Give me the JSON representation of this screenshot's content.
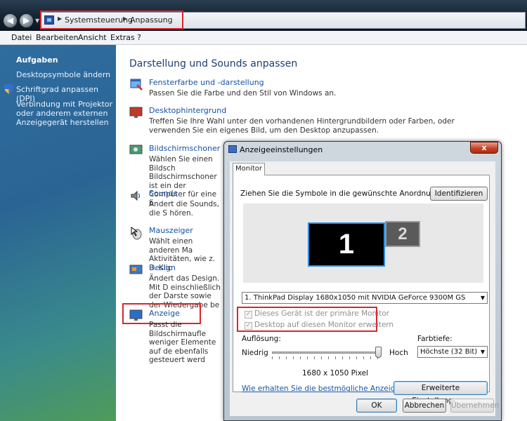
{
  "breadcrumb": {
    "items": [
      "Systemsteuerung",
      "Anpassung"
    ]
  },
  "menu": [
    "Datei",
    "Bearbeiten",
    "Ansicht",
    "Extras",
    "?"
  ],
  "sidebar": {
    "title": "Aufgaben",
    "links": [
      "Desktopsymbole ändern",
      "Schriftgrad anpassen (DPI)",
      "Verbindung mit Projektor oder anderem externen Anzeigegerät herstellen"
    ]
  },
  "main": {
    "title": "Darstellung und Sounds anpassen",
    "items": [
      {
        "title": "Fensterfarbe und -darstellung",
        "desc": "Passen Sie die Farbe und den Stil von Windows an."
      },
      {
        "title": "Desktophintergrund",
        "desc": "Treffen Sie Ihre Wahl unter den vorhandenen Hintergrundbildern oder Farben, oder verwenden Sie ein eigenes Bild, um den Desktop anzupassen."
      },
      {
        "title": "Bildschirmschoner",
        "desc": "Wählen Sie einen Bildsch Bildschirmschoner ist ein der Computer für eine b"
      },
      {
        "title": "Sounds",
        "desc": "Ändert die Sounds, die S hören."
      },
      {
        "title": "Mauszeiger",
        "desc": "Wählt einen anderen Ma Aktivitäten, wie z. B. Klic"
      },
      {
        "title": "Design",
        "desc": "Ändert das Design. Mit D einschließlich der Darste sowie der Wiedergabe be"
      },
      {
        "title": "Anzeige",
        "desc": "Passt die Bildschirmaufle weniger Elemente auf de ebenfalls gesteuert werd"
      }
    ]
  },
  "dialog": {
    "title": "Anzeigeeinstellungen",
    "close": "x",
    "tab": "Monitor",
    "instruction": "Ziehen Sie die Symbole in die gewünschte Anordnung.",
    "identify": "Identifizieren",
    "monitor1": "1",
    "monitor2": "2",
    "display_select": "1. ThinkPad Display 1680x1050 mit NVIDIA GeForce 9300M GS",
    "check_primary": "Dieses Gerät ist der primäre Monitor",
    "check_extend": "Desktop auf diesen Monitor erweitern",
    "resolution_label": "Auflösung:",
    "low": "Niedrig",
    "high": "Hoch",
    "resolution_value": "1680 x 1050 Pixel",
    "color_depth_label": "Farbtiefe:",
    "color_depth_value": "Höchste (32 Bit)",
    "help_link": "Wie erhalten Sie die bestmögliche Anzeige?",
    "advanced": "Erweiterte Einstellungen...",
    "ok": "OK",
    "cancel": "Abbrechen",
    "apply": "Übernehmen"
  }
}
